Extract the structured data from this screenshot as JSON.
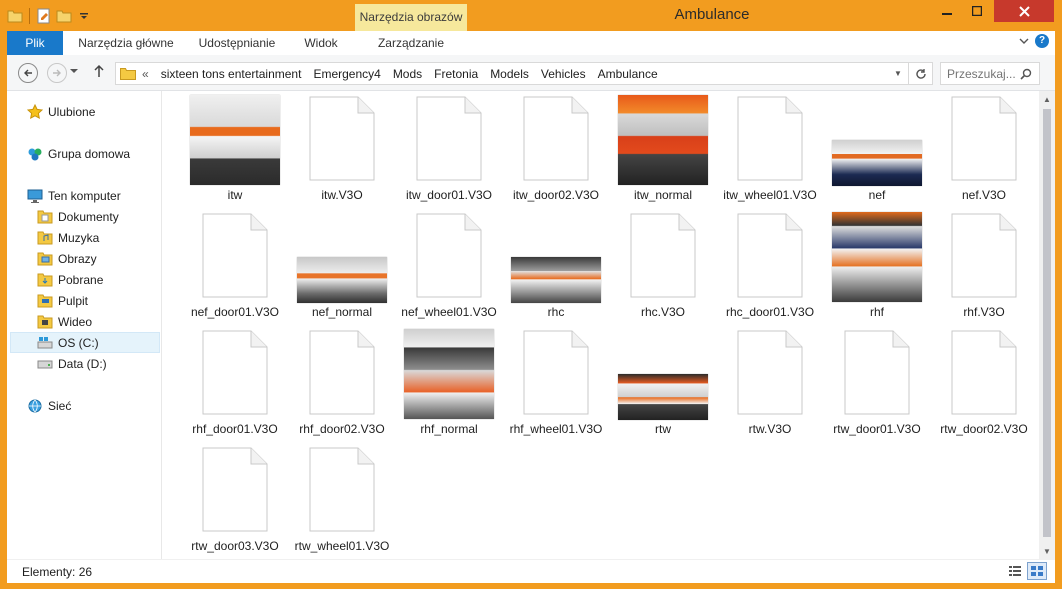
{
  "window": {
    "title": "Ambulance",
    "context_tab": "Narzędzia obrazów",
    "accent": "#f29c1f"
  },
  "ribbon": {
    "tabs": [
      {
        "label": "Plik"
      },
      {
        "label": "Narzędzia główne"
      },
      {
        "label": "Udostępnianie"
      },
      {
        "label": "Widok"
      },
      {
        "label": "Zarządzanie"
      }
    ]
  },
  "address": {
    "prefix": "«",
    "crumbs": [
      "sixteen tons entertainment",
      "Emergency4",
      "Mods",
      "Fretonia",
      "Models",
      "Vehicles",
      "Ambulance"
    ]
  },
  "search": {
    "placeholder": "Przeszukaj..."
  },
  "navpane": {
    "items": [
      {
        "label": "Ulubione",
        "icon": "star-icon"
      },
      {
        "label": "Grupa domowa",
        "icon": "homegroup-icon"
      },
      {
        "label": "Ten komputer",
        "icon": "computer-icon"
      },
      {
        "label": "Dokumenty",
        "icon": "documents-folder-icon"
      },
      {
        "label": "Muzyka",
        "icon": "music-folder-icon"
      },
      {
        "label": "Obrazy",
        "icon": "pictures-folder-icon"
      },
      {
        "label": "Pobrane",
        "icon": "downloads-folder-icon"
      },
      {
        "label": "Pulpit",
        "icon": "desktop-folder-icon"
      },
      {
        "label": "Wideo",
        "icon": "videos-folder-icon"
      },
      {
        "label": "OS (C:)",
        "icon": "system-drive-icon",
        "selected": true
      },
      {
        "label": "Data (D:)",
        "icon": "drive-icon"
      },
      {
        "label": "Sieć",
        "icon": "network-icon"
      }
    ]
  },
  "files": [
    {
      "name": "itw",
      "type": "image"
    },
    {
      "name": "itw.V3O",
      "type": "doc"
    },
    {
      "name": "itw_door01.V3O",
      "type": "doc"
    },
    {
      "name": "itw_door02.V3O",
      "type": "doc"
    },
    {
      "name": "itw_normal",
      "type": "image"
    },
    {
      "name": "itw_wheel01.V3O",
      "type": "doc"
    },
    {
      "name": "nef",
      "type": "image"
    },
    {
      "name": "nef.V3O",
      "type": "doc"
    },
    {
      "name": "nef_door01.V3O",
      "type": "doc"
    },
    {
      "name": "nef_normal",
      "type": "image"
    },
    {
      "name": "nef_wheel01.V3O",
      "type": "doc"
    },
    {
      "name": "rhc",
      "type": "image"
    },
    {
      "name": "rhc.V3O",
      "type": "doc"
    },
    {
      "name": "rhc_door01.V3O",
      "type": "doc"
    },
    {
      "name": "rhf",
      "type": "image"
    },
    {
      "name": "rhf.V3O",
      "type": "doc"
    },
    {
      "name": "rhf_door01.V3O",
      "type": "doc"
    },
    {
      "name": "rhf_door02.V3O",
      "type": "doc"
    },
    {
      "name": "rhf_normal",
      "type": "image"
    },
    {
      "name": "rhf_wheel01.V3O",
      "type": "doc"
    },
    {
      "name": "rtw",
      "type": "image"
    },
    {
      "name": "rtw.V3O",
      "type": "doc"
    },
    {
      "name": "rtw_door01.V3O",
      "type": "doc"
    },
    {
      "name": "rtw_door02.V3O",
      "type": "doc"
    },
    {
      "name": "rtw_door03.V3O",
      "type": "doc"
    },
    {
      "name": "rtw_wheel01.V3O",
      "type": "doc"
    }
  ],
  "status": {
    "items_text": "Elementy: 26"
  }
}
